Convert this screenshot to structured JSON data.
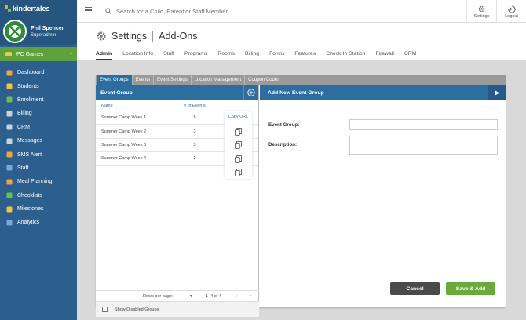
{
  "app": {
    "brand": "kindertales"
  },
  "user": {
    "name": "Phil Spencer",
    "role": "Superadmin"
  },
  "sidebar": {
    "active_item": "PC Games",
    "items": [
      {
        "label": "Dashboard",
        "icon": "dashboard-icon",
        "color": "#f3a33b"
      },
      {
        "label": "Students",
        "icon": "students-icon",
        "color": "#f3c33b"
      },
      {
        "label": "Enrollment",
        "icon": "enrollment-icon",
        "color": "#6cc04a"
      },
      {
        "label": "Billing",
        "icon": "billing-icon",
        "color": "#c9d3df"
      },
      {
        "label": "CRM",
        "icon": "crm-icon",
        "color": "#c9d3df"
      },
      {
        "label": "Messages",
        "icon": "messages-icon",
        "color": "#c9d3df"
      },
      {
        "label": "SMS Alert",
        "icon": "sms-alert-icon",
        "color": "#f3a33b"
      },
      {
        "label": "Staff",
        "icon": "staff-icon",
        "color": "#7aa8d8"
      },
      {
        "label": "Meal Planning",
        "icon": "meal-planning-icon",
        "color": "#f3a33b"
      },
      {
        "label": "Checklists",
        "icon": "checklists-icon",
        "color": "#6cc04a"
      },
      {
        "label": "Milestones",
        "icon": "milestones-icon",
        "color": "#f3c33b"
      },
      {
        "label": "Analytics",
        "icon": "analytics-icon",
        "color": "#7aa8d8"
      }
    ]
  },
  "topbar": {
    "search_placeholder": "Search for a Child, Parent or Staff Member",
    "settings_label": "Settings",
    "logout_label": "Logout"
  },
  "header": {
    "title": "Settings",
    "subtitle": "Add-Ons",
    "tabs": [
      "Admin",
      "Location Info",
      "Staff",
      "Programs",
      "Rooms",
      "Billing",
      "Forms",
      "Features",
      "Check-In Station",
      "Firewall",
      "CRM"
    ],
    "active_tab": "Admin"
  },
  "subtabs": [
    "Event Groups",
    "Events",
    "Event Settings",
    "Location Management",
    "Coupon Codes"
  ],
  "event_group": {
    "title": "Event Group",
    "columns": {
      "name": "Name",
      "count": "# of Events",
      "copy": "Copy URL"
    },
    "rows": [
      {
        "name": "Summer Camp Week 1",
        "count": "8"
      },
      {
        "name": "Summer Camp Week 2",
        "count": "3"
      },
      {
        "name": "Summer Camp Week 3",
        "count": "3"
      },
      {
        "name": "Summer Camp Week 4",
        "count": "2"
      }
    ],
    "pager": {
      "rows_label": "Rows per page:",
      "range": "1–4 of 4"
    },
    "show_disabled_label": "Show Disabled Groups"
  },
  "new_group": {
    "title": "Add New Event Group",
    "event_group_label": "Event Group:",
    "description_label": "Description:",
    "cancel_label": "Cancel",
    "save_label": "Save & Add"
  },
  "colors": {
    "primary": "#2c6ea0",
    "sidebar": "#2c5f8e",
    "accent_green": "#5fa13c"
  }
}
